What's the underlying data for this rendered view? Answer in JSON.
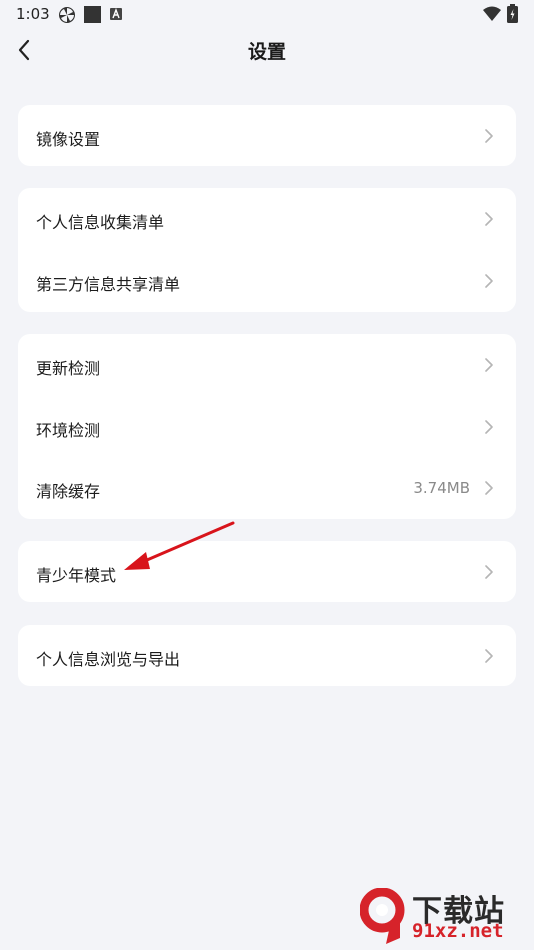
{
  "status_bar": {
    "time": "1:03",
    "icons": [
      "pinwheel-icon",
      "square-icon",
      "a-badge-icon",
      "wifi-icon",
      "battery-charging-icon"
    ]
  },
  "header": {
    "title": "设置",
    "back_icon": "chevron-left-icon"
  },
  "groups": [
    {
      "items": [
        {
          "label": "镜像设置",
          "value": ""
        }
      ]
    },
    {
      "items": [
        {
          "label": "个人信息收集清单",
          "value": ""
        },
        {
          "label": "第三方信息共享清单",
          "value": ""
        }
      ]
    },
    {
      "items": [
        {
          "label": "更新检测",
          "value": ""
        },
        {
          "label": "环境检测",
          "value": ""
        },
        {
          "label": "清除缓存",
          "value": "3.74MB"
        }
      ]
    },
    {
      "items": [
        {
          "label": "青少年模式",
          "value": ""
        }
      ]
    },
    {
      "items": [
        {
          "label": "个人信息浏览与导出",
          "value": ""
        }
      ]
    }
  ],
  "annotation": {
    "color": "#d8141b"
  },
  "watermark": {
    "text": "下载站",
    "url": "91xz.net",
    "accent": "#d6232a"
  },
  "colors": {
    "background": "#f3f4f8",
    "card": "#ffffff",
    "chevron": "#b5b5b5",
    "value_text": "#8a8a8a"
  }
}
